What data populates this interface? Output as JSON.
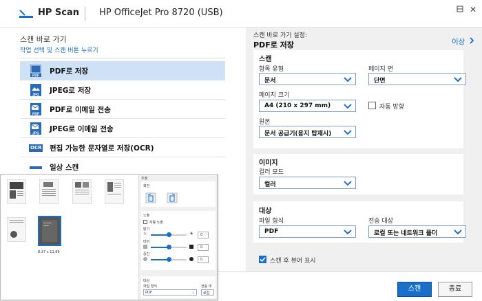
{
  "app": {
    "name": "HP Scan",
    "printer": "HP OfficeJet Pro 8720 (USB)"
  },
  "left": {
    "heading": "스캔 바로 가기",
    "subheading": "작업 선택 및 스캔 버튼 누르기",
    "shortcuts": [
      {
        "label": "PDF로 저장",
        "icon": "pdf-document-icon",
        "selected": true
      },
      {
        "label": "JPEG로 저장",
        "icon": "jpeg-document-icon",
        "selected": false
      },
      {
        "label": "PDF로 이메일 전송",
        "icon": "pdf-email-icon",
        "selected": false
      },
      {
        "label": "JPEG로 이메일 전송",
        "icon": "jpeg-email-icon",
        "selected": false
      },
      {
        "label": "편집 가능한 문자열로 저장(OCR)",
        "icon": "ocr-icon",
        "selected": false
      },
      {
        "label": "일상 스캔",
        "icon": "everyday-scan-icon",
        "selected": false
      }
    ],
    "ocr_badge": "OCR"
  },
  "right": {
    "heading": "스캔 바로 가기 설정:",
    "title": "PDF로 저장",
    "less_link": "이상",
    "scan": {
      "title": "스캔",
      "item_type_label": "항목 유형",
      "item_type": "문서",
      "page_side_label": "페이지 면",
      "page_side": "단면",
      "page_size_label": "페이지 크기",
      "page_size": "A4 (210 x 297 mm)",
      "auto_orient_label": "자동 방향",
      "auto_orient": false,
      "source_label": "원본",
      "source": "문서 공급기(용지 탑재시)"
    },
    "image": {
      "title": "이미지",
      "color_mode_label": "컬러 모드",
      "color_mode": "컬러"
    },
    "destination": {
      "title": "대상",
      "file_type_label": "파일 형식",
      "file_type": "PDF",
      "send_to_label": "전송 대상",
      "send_to": "로컬 또는 네트워크 폴더"
    },
    "show_viewer_label": "스캔 후 뷰어 표시",
    "show_viewer": true
  },
  "buttons": {
    "scan": "스캔",
    "exit": "종료"
  },
  "preview": {
    "size_label": "8.27 x 11.69",
    "adjust_title": "조정",
    "rotate_label": "회전",
    "exposure_label": "노출",
    "auto_exposure_label": "자동 노출",
    "brightness_label": "밝기",
    "contrast_label": "대비",
    "midtone_label": "중간",
    "brightness_value": "0",
    "contrast_value": "0",
    "midtone_value": "0",
    "brightness_level": 0.5,
    "contrast_level": 0.5,
    "midtone_level": 0.5,
    "dest_title": "대상",
    "file_type_label": "파일 형식",
    "file_type": "PDF",
    "send_to_label": "전송 대",
    "send_to": "로컬"
  },
  "colors": {
    "accent": "#1a6fc9",
    "selected_bg": "#cfe1f5",
    "pdf_red": "#c8202f"
  }
}
